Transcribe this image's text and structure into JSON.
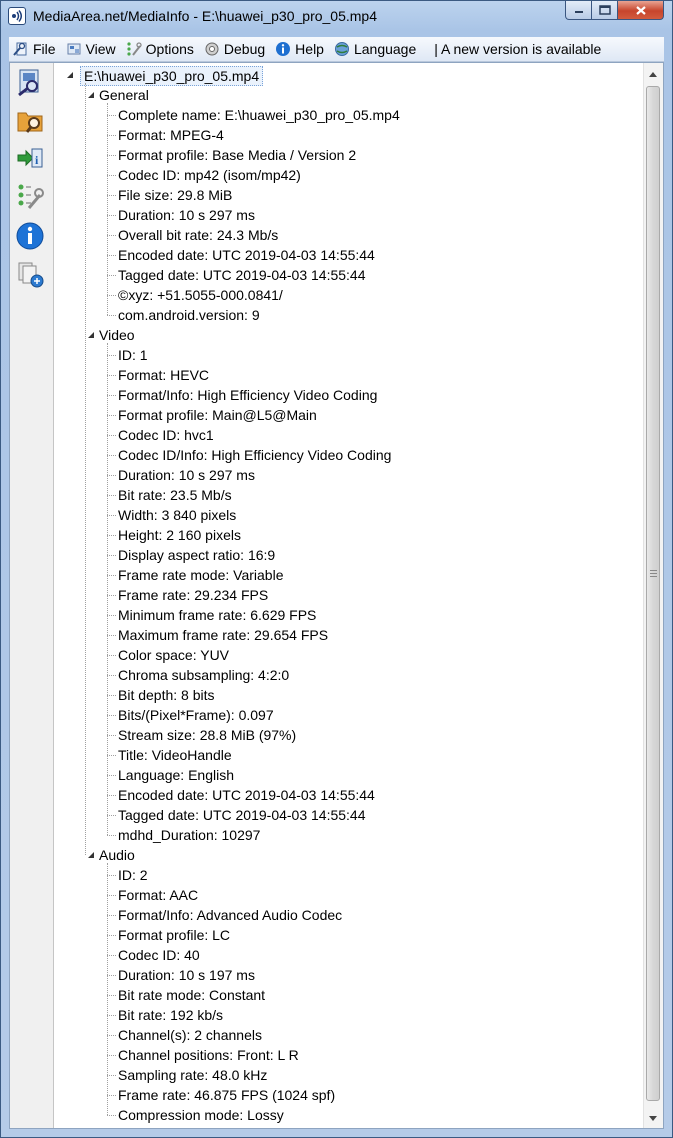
{
  "window": {
    "title": "MediaArea.net/MediaInfo - E:\\huawei_p30_pro_05.mp4"
  },
  "menu": {
    "items": [
      {
        "label": "File",
        "icon": "file-icon"
      },
      {
        "label": "View",
        "icon": "view-icon"
      },
      {
        "label": "Options",
        "icon": "options-icon"
      },
      {
        "label": "Debug",
        "icon": "debug-icon"
      },
      {
        "label": "Help",
        "icon": "help-icon"
      },
      {
        "label": "Language",
        "icon": "language-icon"
      }
    ],
    "notice": "| A new version is available"
  },
  "toolbar": {
    "buttons": [
      "open-file-icon",
      "open-folder-icon",
      "export-icon",
      "preferences-icon",
      "about-icon",
      "new-version-icon"
    ]
  },
  "tree": {
    "root": "E:\\huawei_p30_pro_05.mp4",
    "sections": [
      {
        "name": "General",
        "items": [
          "Complete name: E:\\huawei_p30_pro_05.mp4",
          "Format: MPEG-4",
          "Format profile: Base Media / Version 2",
          "Codec ID: mp42 (isom/mp42)",
          "File size: 29.8 MiB",
          "Duration: 10 s 297 ms",
          "Overall bit rate: 24.3 Mb/s",
          "Encoded date: UTC 2019-04-03 14:55:44",
          "Tagged date: UTC 2019-04-03 14:55:44",
          "©xyz: +51.5055-000.0841/",
          "com.android.version: 9"
        ]
      },
      {
        "name": "Video",
        "items": [
          "ID: 1",
          "Format: HEVC",
          "Format/Info: High Efficiency Video Coding",
          "Format profile: Main@L5@Main",
          "Codec ID: hvc1",
          "Codec ID/Info: High Efficiency Video Coding",
          "Duration: 10 s 297 ms",
          "Bit rate: 23.5 Mb/s",
          "Width: 3 840 pixels",
          "Height: 2 160 pixels",
          "Display aspect ratio: 16:9",
          "Frame rate mode: Variable",
          "Frame rate: 29.234 FPS",
          "Minimum frame rate: 6.629 FPS",
          "Maximum frame rate: 29.654 FPS",
          "Color space: YUV",
          "Chroma subsampling: 4:2:0",
          "Bit depth: 8 bits",
          "Bits/(Pixel*Frame): 0.097",
          "Stream size: 28.8 MiB (97%)",
          "Title: VideoHandle",
          "Language: English",
          "Encoded date: UTC 2019-04-03 14:55:44",
          "Tagged date: UTC 2019-04-03 14:55:44",
          "mdhd_Duration: 10297"
        ]
      },
      {
        "name": "Audio",
        "items": [
          "ID: 2",
          "Format: AAC",
          "Format/Info: Advanced Audio Codec",
          "Format profile: LC",
          "Codec ID: 40",
          "Duration: 10 s 197 ms",
          "Bit rate mode: Constant",
          "Bit rate: 192 kb/s",
          "Channel(s): 2 channels",
          "Channel positions: Front: L R",
          "Sampling rate: 48.0 kHz",
          "Frame rate: 46.875 FPS (1024 spf)",
          "Compression mode: Lossy"
        ]
      }
    ]
  },
  "colors": {
    "frame": "#b5cbe8",
    "close_button": "#c7452c",
    "selection": "#eaf2fc"
  }
}
